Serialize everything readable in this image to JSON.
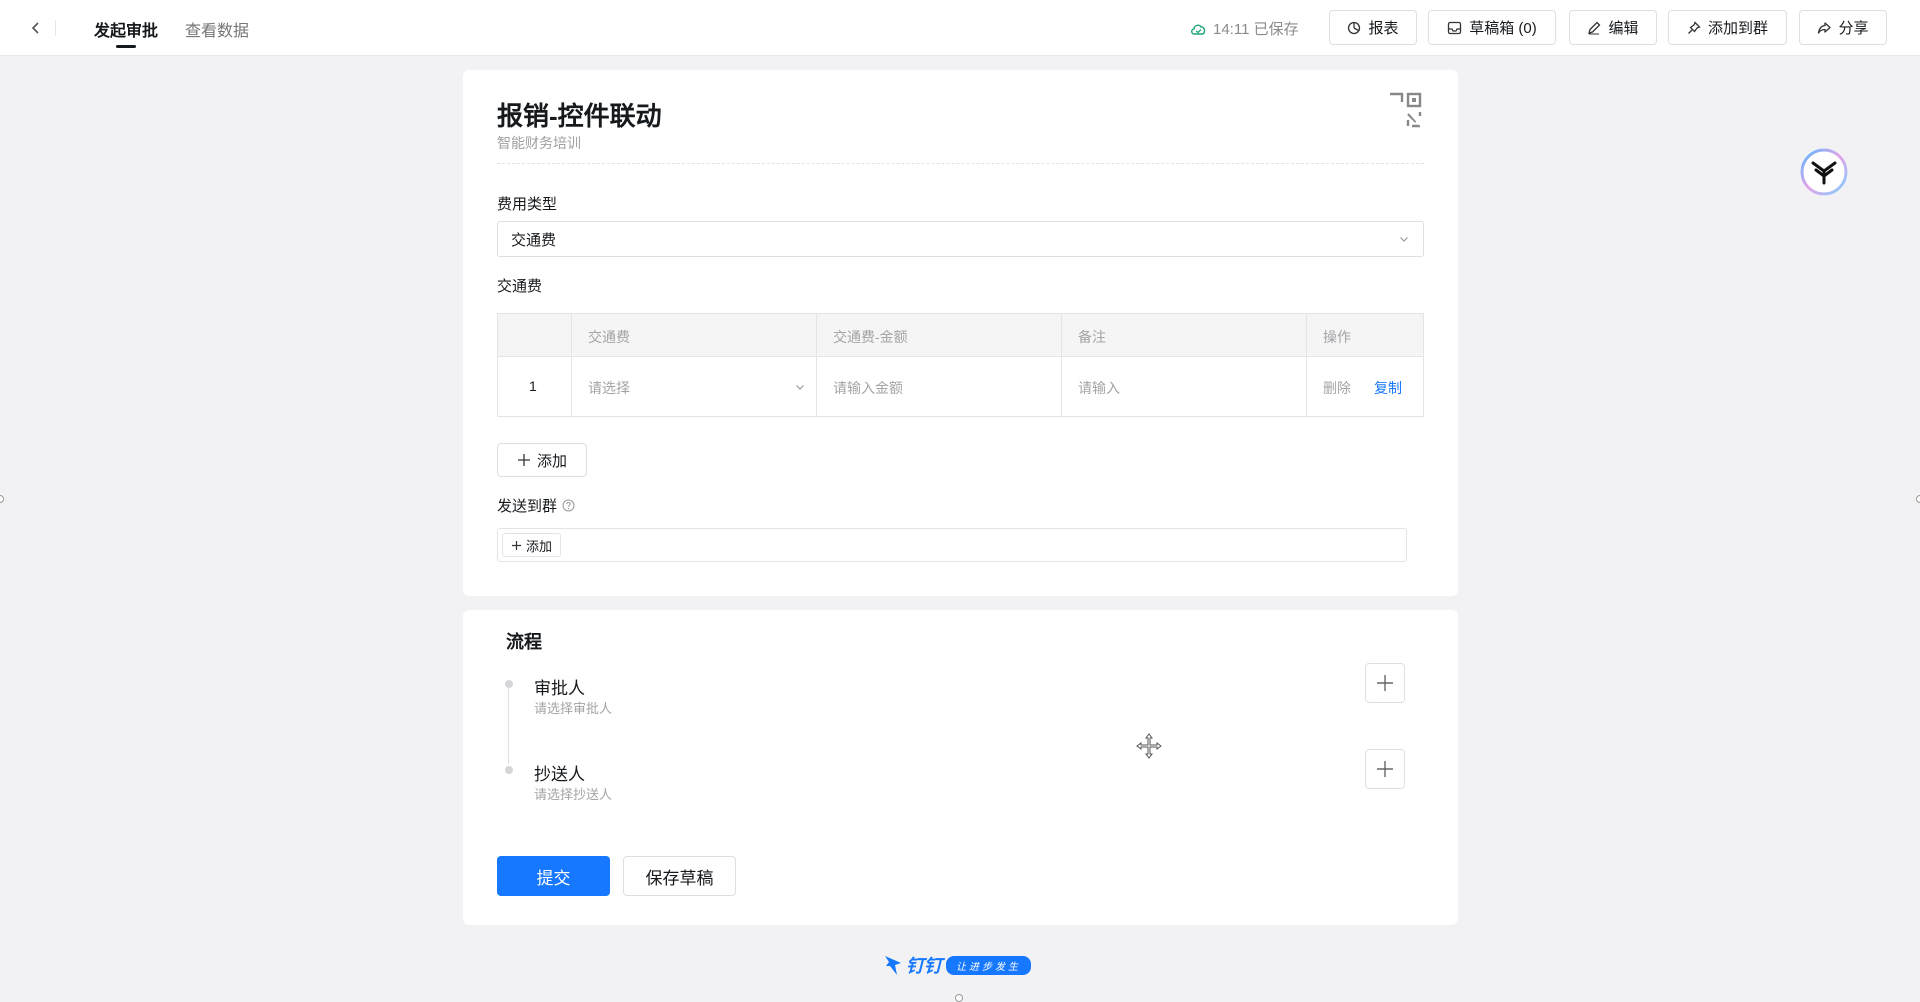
{
  "topbar": {
    "tabs": [
      {
        "label": "发起审批",
        "active": true
      },
      {
        "label": "查看数据",
        "active": false
      }
    ],
    "save_status": "14:11 已保存",
    "buttons": {
      "report": "报表",
      "drafts": "草稿箱 (0)",
      "edit": "编辑",
      "add_to_group": "添加到群",
      "share": "分享"
    }
  },
  "form": {
    "title": "报销-控件联动",
    "subtitle": "智能财务培训",
    "expense_type": {
      "label": "费用类型",
      "value": "交通费"
    },
    "table": {
      "label": "交通费",
      "headers": [
        "交通费",
        "交通费-金额",
        "备注",
        "操作"
      ],
      "rows": [
        {
          "index": "1",
          "type_placeholder": "请选择",
          "amount_placeholder": "请输入金额",
          "remark_placeholder": "请输入",
          "delete": "删除",
          "copy": "复制"
        }
      ],
      "add_label": "添加"
    },
    "send_to_group": {
      "label": "发送到群",
      "add_label": "添加"
    }
  },
  "flow": {
    "title": "流程",
    "steps": [
      {
        "name": "审批人",
        "hint": "请选择审批人"
      },
      {
        "name": "抄送人",
        "hint": "请选择抄送人"
      }
    ]
  },
  "actions": {
    "submit": "提交",
    "save_draft": "保存草稿"
  },
  "footer": {
    "brand": "钉钉",
    "slogan": "让进步发生"
  },
  "colors": {
    "primary": "#1677ff",
    "saved_cloud": "#1fa37a"
  }
}
